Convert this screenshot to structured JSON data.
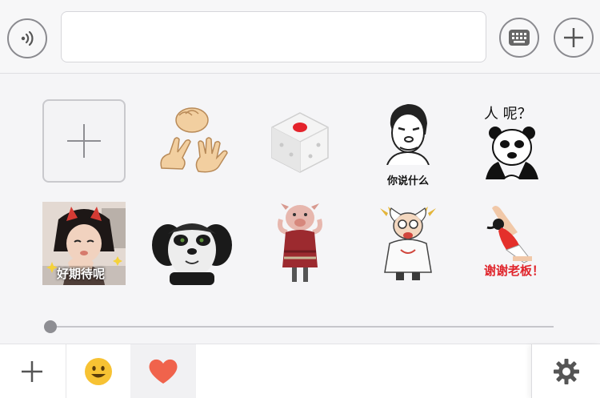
{
  "input_bar": {
    "voice_icon": "voice-input-icon",
    "text_value": "",
    "keyboard_icon": "keyboard-icon",
    "more_icon": "plus-icon"
  },
  "stickers": {
    "add_icon": "plus-icon",
    "items": [
      {
        "name": "rock-paper-scissors",
        "caption": ""
      },
      {
        "name": "dice",
        "caption": ""
      },
      {
        "name": "meme-face",
        "caption": "你说什么"
      },
      {
        "name": "panda-meme",
        "caption": "人 呢？"
      },
      {
        "name": "girl-photo",
        "caption": "好期待呢"
      },
      {
        "name": "kung-fu-panda",
        "caption": ""
      },
      {
        "name": "pig-character",
        "caption": ""
      },
      {
        "name": "old-scientist",
        "caption": ""
      },
      {
        "name": "thanks-boss",
        "caption": "谢谢老板！"
      }
    ]
  },
  "page_slider": {
    "position": 0
  },
  "bottom_bar": {
    "tabs": [
      {
        "name": "add",
        "icon": "plus-icon"
      },
      {
        "name": "emoji",
        "icon": "smiley-icon"
      },
      {
        "name": "favorites",
        "icon": "heart-icon",
        "selected": true
      }
    ],
    "settings_icon": "gear-icon"
  },
  "colors": {
    "heart": "#f0634c",
    "smiley": "#f7c233",
    "thanks_text": "#e0242b",
    "dice_dot": "#e4232b"
  }
}
